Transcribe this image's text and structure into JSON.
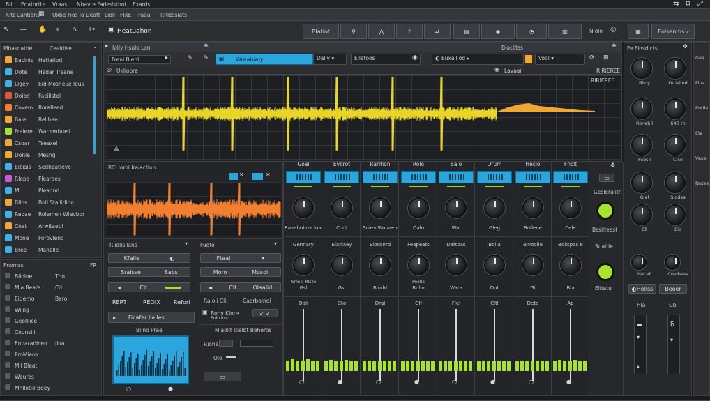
{
  "menu": [
    "Bill",
    "Edatortte",
    "Vraas",
    "Nbavte Fades",
    "Istbol",
    "Exards"
  ],
  "menu2": [
    "Xite",
    "Cantiens",
    "Uxbe",
    "Fios Io",
    "Deatt",
    "Lioll",
    "FIXE",
    "Faaa",
    "Rnlessiats"
  ],
  "toolbar": {
    "project_title": "Heatuahon",
    "tool_label": "Blatiot",
    "mode_label": "Niolo",
    "options_label": "Eolsenms"
  },
  "library": {
    "title": "Mbasnathe",
    "header_right": "Cealdise",
    "items": [
      {
        "name": "Bacinis",
        "desc": "Hatlatiod",
        "color": "#f0a830"
      },
      {
        "name": "Dote",
        "desc": "Hedar Treane",
        "color": "#3fb1e8"
      },
      {
        "name": "Llgey",
        "desc": "Eld Mosneue leus",
        "color": "#3fb1e8"
      },
      {
        "name": "Doiod",
        "desc": "Facilistel",
        "color": "#e0553b"
      },
      {
        "name": "Covem",
        "desc": "Roralleed",
        "color": "#f07f30"
      },
      {
        "name": "Bale",
        "desc": "Rellbee",
        "color": "#f0a830"
      },
      {
        "name": "Fraiere",
        "desc": "Wacemhuell",
        "color": "#a6e22e"
      },
      {
        "name": "Csoar",
        "desc": "Tseaxel",
        "color": "#f0a830"
      },
      {
        "name": "Donle",
        "desc": "Meshg",
        "color": "#f0a830"
      },
      {
        "name": "Eibisis",
        "desc": "Sedheatieve",
        "color": "#3fb1e8"
      },
      {
        "name": "Rlepo",
        "desc": "Flearaes",
        "color": "#c85ad8"
      },
      {
        "name": "Mi",
        "desc": "Pleadnd",
        "color": "#3fb1e8"
      },
      {
        "name": "Bllos",
        "desc": "Boll Stallidion",
        "color": "#f0a830"
      },
      {
        "name": "Reoae",
        "desc": "Rolemen Wlavbor",
        "color": "#3fb1e8"
      },
      {
        "name": "Coat",
        "desc": "Arwitaepl",
        "color": "#f0a830"
      },
      {
        "name": "Mone",
        "desc": "Forovlenc",
        "color": "#3fb1e8"
      },
      {
        "name": "Bree",
        "desc": "Manelle",
        "color": "#3fb1e8"
      }
    ]
  },
  "browser": {
    "title": "Fnomss",
    "header_right": "FR",
    "items": [
      {
        "name": "Biloloe",
        "desc": "Tho"
      },
      {
        "name": "Mla Beara",
        "desc": "Cd"
      },
      {
        "name": "Eiderno",
        "desc": "Baro"
      },
      {
        "name": "Wiing",
        "desc": ""
      },
      {
        "name": "Geolllice",
        "desc": ""
      },
      {
        "name": "Counslli",
        "desc": ""
      },
      {
        "name": "Eonaradicen",
        "desc": "Iloa"
      },
      {
        "name": "ProMiaos",
        "desc": ""
      },
      {
        "name": "Mll Bleat",
        "desc": ""
      },
      {
        "name": "Weures",
        "desc": ""
      },
      {
        "name": "Mhllotio Bdey",
        "desc": ""
      }
    ]
  },
  "editor": {
    "title": "Iolly Hsulo Lon",
    "clip_name": "Wreabialy",
    "field1": "Frenl Bienl",
    "field2": "Dally",
    "field3": "Ellatoos",
    "field4": "Euxalllod",
    "field5": "Vool",
    "field6": "Uklioore",
    "field7": "Lavaar",
    "field8": "Bioclitss",
    "readout": "RIRIEREE"
  },
  "sampler": {
    "title": "RCI Iomi Iraiaction",
    "sub_title": "Riidlisllans",
    "sub2": "Fuoto",
    "rows": [
      "Kfaile",
      "Sraisse",
      "Ftaal",
      "Moro",
      "Sabs",
      "Mosol",
      "Cit",
      "Olaalid"
    ],
    "tabs": [
      "RERT",
      "REOIX",
      "Refori"
    ],
    "mini_title": "Bilno Prae",
    "mini_sub": "Ficafer llelles",
    "right_title": "Raioli Cill",
    "right_sub": "Caorboinoi",
    "right_field": "Booy Klore",
    "right_field_sub": "Enltcoss",
    "right_block": "Mlaolit dialbt Beheros",
    "right_label1": "Riohe",
    "right_label2": "Oio"
  },
  "mixer": {
    "channels": [
      {
        "name": "Goal",
        "k1": "Ravehuiner luas",
        "k2": "Gennary",
        "k2b": "Gnlolli Rlsile",
        "k2c": "Gsl",
        "bottom": "Oali",
        "level": 0.62
      },
      {
        "name": "Evorot",
        "k1": "Coct",
        "k2": "Elattaey",
        "k2b": "",
        "k2c": "Gsl",
        "bottom": "Elio",
        "level": 0.55
      },
      {
        "name": "Rarition",
        "k1": "Sniev Wouaen",
        "k2": "Eiodsnrd",
        "k2b": "",
        "k2c": "Bludd",
        "bottom": "Drgl",
        "level": 0.48
      },
      {
        "name": "Rolo",
        "k1": "Oalo",
        "k2": "Feapeats",
        "k2b": "Poolla",
        "k2c": "Bullo",
        "bottom": "Gfl",
        "level": 0.52
      },
      {
        "name": "Balo",
        "k1": "Wal",
        "k2": "Dattoas",
        "k2b": "",
        "k2c": "Wata",
        "bottom": "Flel",
        "level": 0.5
      },
      {
        "name": "Drum",
        "k1": "Gleg",
        "k2": "Bolla",
        "k2b": "",
        "k2c": "Dot",
        "bottom": "Cltl",
        "level": 0.47
      },
      {
        "name": "Heclo",
        "k1": "Bnllene",
        "k2": "Bivodlle",
        "k2b": "",
        "k2c": "Gi",
        "bottom": "Deto",
        "level": 0.49
      },
      {
        "name": "Fnclt",
        "k1": "Cele",
        "k2": "Bollspas 6",
        "k2b": "",
        "k2c": "Bla",
        "bottom": "Ap",
        "level": 0.6
      }
    ],
    "fx": {
      "header": "",
      "label": "Gesleralitn",
      "sub": "Bssilteest",
      "k2": "Sualtie",
      "k2b": "Elbatu"
    }
  },
  "rightpanel": {
    "title": "Fe Flosdlcts",
    "k_labels": [
      "Blioy",
      "Fetiallod",
      "Ronebll",
      "640 th",
      "Fsosll",
      "Ciso",
      "Glel",
      "Slodes",
      "Ell",
      "Eio"
    ],
    "k_labels2": [
      "Hacell",
      "Coeibess"
    ],
    "buttons": [
      "Hellss",
      "Beoer"
    ],
    "bottom_labels": [
      "Hla",
      "Gbi"
    ]
  },
  "farright": {
    "labels": [
      "Gaa",
      "Flua",
      "Eotila",
      "Eta",
      "Vaxe",
      "Nutee"
    ]
  }
}
